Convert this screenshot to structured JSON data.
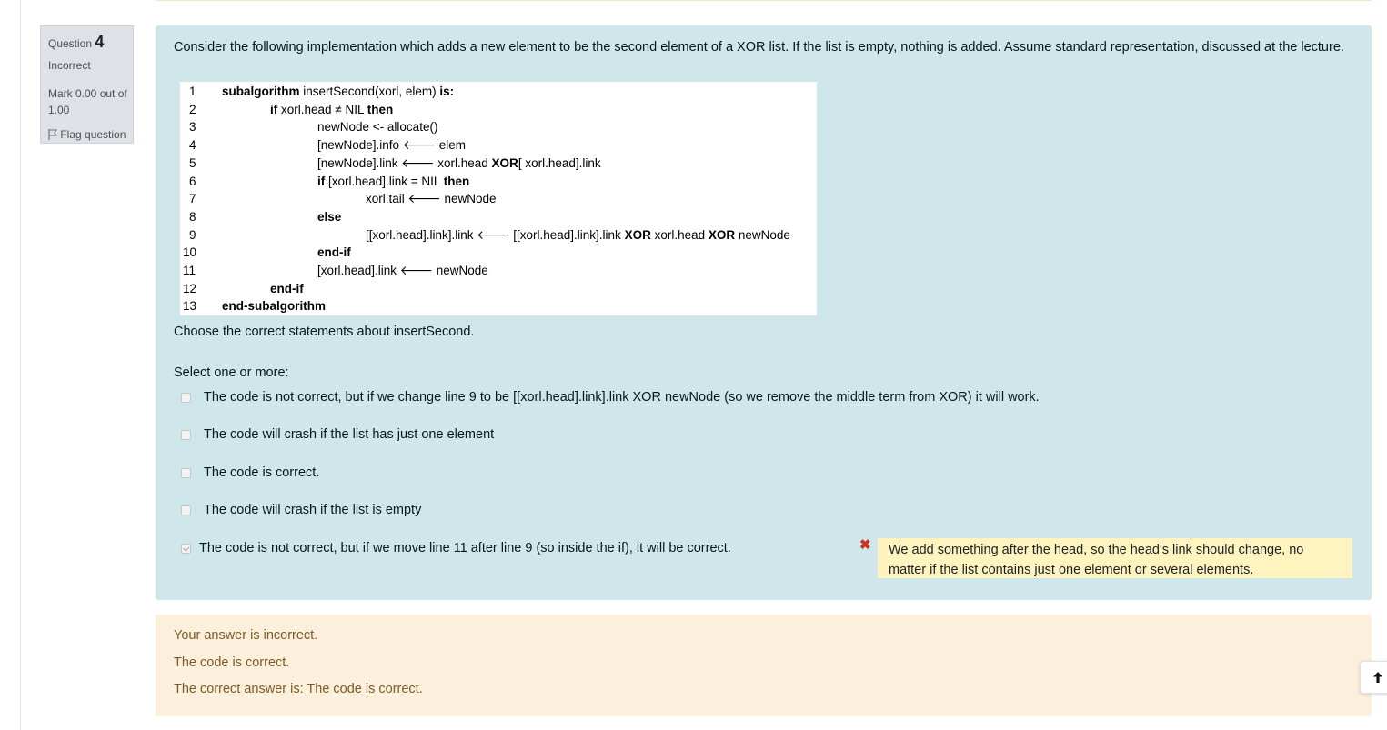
{
  "info": {
    "question_label": "Question",
    "question_number": "4",
    "state": "Incorrect",
    "grade": "Mark 0.00 out of 1.00",
    "flag_label": "Flag question"
  },
  "question": {
    "text": "Consider the following implementation which adds a new element to be the second element of a XOR list. If the list is empty, nothing is added. Assume standard representation, discussed at the lecture.",
    "code_lines": [
      {
        "n": "1",
        "segs": [
          {
            "t": "subalgorithm",
            "b": true
          },
          {
            "t": " insertSecond(xorl, elem) ",
            "b": false
          },
          {
            "t": "is:",
            "b": true
          }
        ]
      },
      {
        "n": "2",
        "segs": [
          {
            "t": "if",
            "b": true
          },
          {
            "t": " xorl.head ≠ NIL ",
            "b": false
          },
          {
            "t": "then",
            "b": true
          }
        ]
      },
      {
        "n": "3",
        "segs": [
          {
            "t": "newNode <- allocate()",
            "b": false
          }
        ]
      },
      {
        "n": "4",
        "segs": [
          {
            "t": "[newNode].info 🡐 elem",
            "b": false
          }
        ]
      },
      {
        "n": "5",
        "segs": [
          {
            "t": "[newNode].link 🡐 xorl.head ",
            "b": false
          },
          {
            "t": "XOR",
            "b": true
          },
          {
            "t": "[ xorl.head].link",
            "b": false
          }
        ]
      },
      {
        "n": "6",
        "segs": [
          {
            "t": "if",
            "b": true
          },
          {
            "t": " [xorl.head].link = NIL ",
            "b": false
          },
          {
            "t": "then",
            "b": true
          }
        ]
      },
      {
        "n": "7",
        "segs": [
          {
            "t": "xorl.tail 🡐 newNode",
            "b": false
          }
        ]
      },
      {
        "n": "8",
        "segs": [
          {
            "t": "else",
            "b": true
          }
        ]
      },
      {
        "n": "9",
        "segs": [
          {
            "t": "[[xorl.head].link].link 🡐 [[xorl.head].link].link ",
            "b": false
          },
          {
            "t": "XOR",
            "b": true
          },
          {
            "t": " xorl.head ",
            "b": false
          },
          {
            "t": "XOR",
            "b": true
          },
          {
            "t": " newNode",
            "b": false
          }
        ]
      },
      {
        "n": "10",
        "segs": [
          {
            "t": "end-if",
            "b": true
          }
        ]
      },
      {
        "n": "11",
        "segs": [
          {
            "t": "[xorl.head].link 🡐 newNode",
            "b": false
          }
        ]
      },
      {
        "n": "12",
        "segs": [
          {
            "t": "end-if",
            "b": true
          }
        ]
      },
      {
        "n": "13",
        "segs": [
          {
            "t": "end-subalgorithm",
            "b": true
          }
        ]
      }
    ],
    "prompt": "Choose the correct statements about insertSecond.",
    "select_label": "Select one or more:",
    "options": [
      {
        "label": "The code is not correct, but if we change line 9 to be [[xorl.head].link].link XOR newNode (so we remove the middle term from XOR) it will work.",
        "checked": false
      },
      {
        "label": "The code will crash if the list has just one element",
        "checked": false
      },
      {
        "label": "The code is correct.",
        "checked": false
      },
      {
        "label": "The code will crash if the list is empty",
        "checked": false
      },
      {
        "label": "The code is not correct, but if we move line 11 after line 9 (so inside the if), it will be correct.",
        "checked": true
      }
    ],
    "feedback_mark": "✖",
    "feedback": "We add something after the head, so the head's link should change, no matter if the list contains just one element or several elements."
  },
  "outcome": {
    "result": "Your answer is incorrect.",
    "specific": "The code is correct.",
    "right_answer": "The correct answer is: The code is correct."
  },
  "colors": {
    "formulation_bg": "#cfe6ea",
    "outcome_bg": "#fcefdc",
    "feedback_bg": "#fff3bf",
    "incorrect_red": "#ca3120"
  }
}
